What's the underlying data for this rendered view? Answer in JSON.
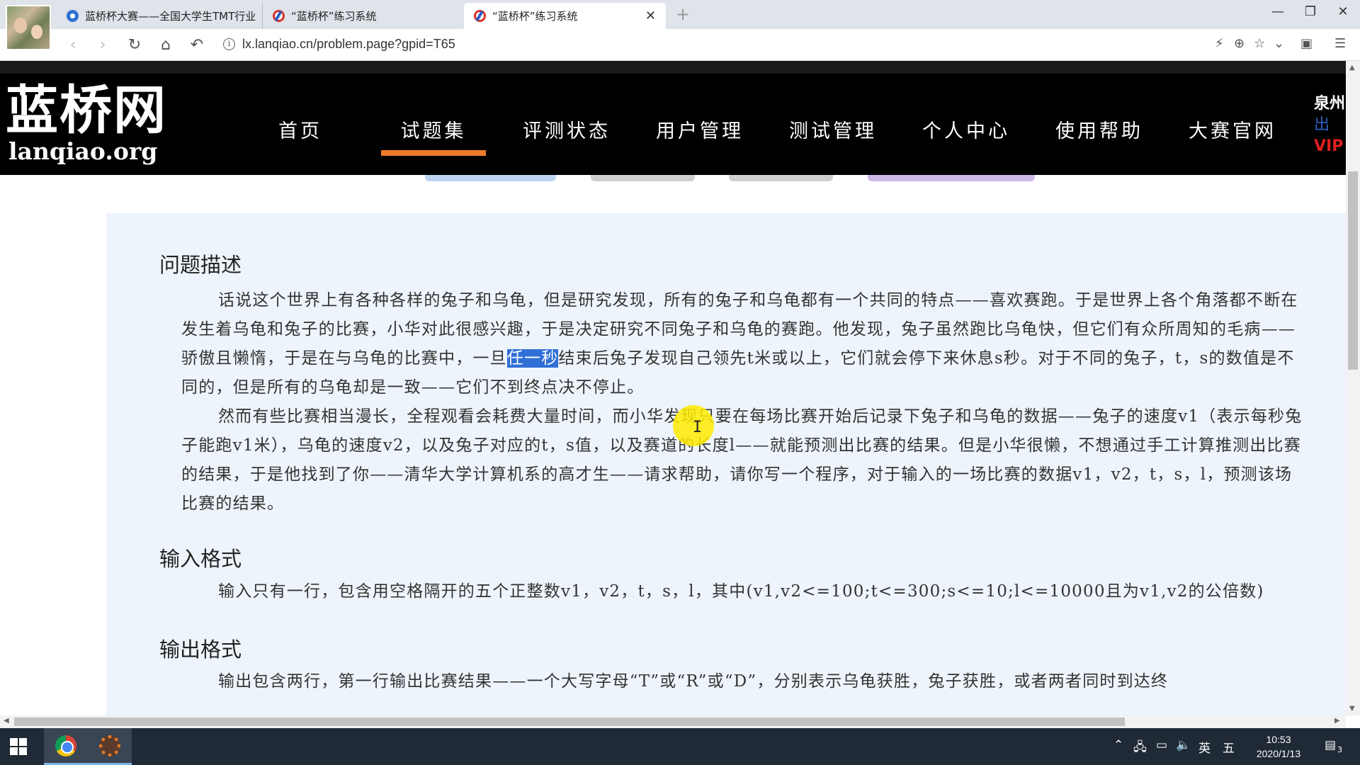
{
  "browser": {
    "tabs": [
      {
        "title": "蓝桥杯大赛——全国大学生TMT行业"
      },
      {
        "title": "“蓝桥杯”练习系统"
      },
      {
        "title": "“蓝桥杯”练习系统"
      }
    ],
    "url": "lx.lanqiao.cn/problem.page?gpid=T65"
  },
  "site": {
    "logo_cn": "蓝桥网",
    "logo_en": "lanqiao.org",
    "nav": [
      "首页",
      "试题集",
      "评测状态",
      "用户管理",
      "测试管理",
      "个人中心",
      "使用帮助",
      "大赛官网"
    ],
    "active_nav": "试题集",
    "header_right": [
      "泉州",
      "出",
      "VIP"
    ]
  },
  "problem": {
    "description_title": "问题描述",
    "description_p1_a": "话说这个世界上有各种各样的兔子和乌龟，但是研究发现，所有的兔子和乌龟都有一个共同的特点——喜欢赛跑。于是世界上各个角落都不断在发生着乌龟和兔子的比赛，小华对此很感兴趣，于是决定研究不同兔子和乌龟的赛跑。他发现，兔子虽然跑比乌龟快，但它们有众所周知的毛病——骄傲且懒惰，于是在与乌龟的比赛中，一旦",
    "description_p1_highlight": "任一秒",
    "description_p1_b": "结束后兔子发现自己领先t米或以上，它们就会停下来休息s秒。对于不同的兔子，t，s的数值是不同的，但是所有的乌龟却是一致——它们不到终点决不停止。",
    "description_p2": "然而有些比赛相当漫长，全程观看会耗费大量时间，而小华发现只要在每场比赛开始后记录下兔子和乌龟的数据——兔子的速度v1（表示每秒兔子能跑v1米），乌龟的速度v2，以及兔子对应的t，s值，以及赛道的长度l——就能预测出比赛的结果。但是小华很懒，不想通过手工计算推测出比赛的结果，于是他找到了你——清华大学计算机系的高才生——请求帮助，请你写一个程序，对于输入的一场比赛的数据v1，v2，t，s，l，预测该场比赛的结果。",
    "input_title": "输入格式",
    "input_text": "输入只有一行，包含用空格隔开的五个正整数v1，v2，t，s，l，其中(v1,v2<=100;t<=300;s<=10;l<=10000且为v1,v2的公倍数)",
    "output_title": "输出格式",
    "output_text": "输出包含两行，第一行输出比赛结果——一个大写字母“T”或“R”或“D”，分别表示乌龟获胜，兔子获胜，或者两者同时到达终"
  },
  "taskbar": {
    "ime_lang": "英",
    "ime_mode": "五",
    "time": "10:53",
    "date": "2020/1/13",
    "notification_count": "3"
  }
}
